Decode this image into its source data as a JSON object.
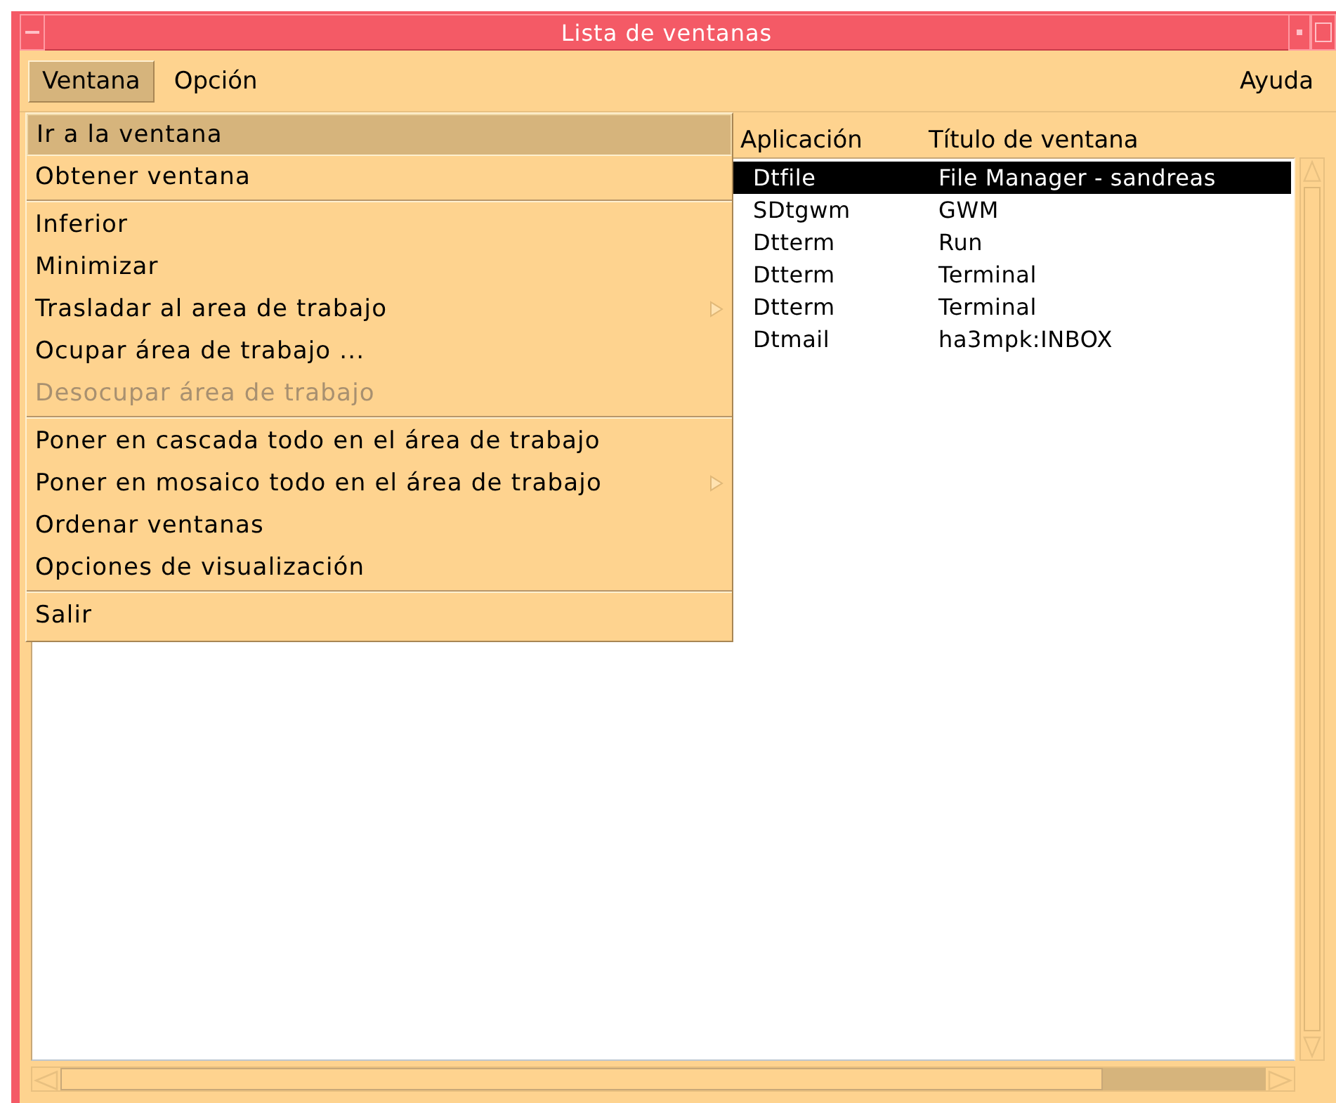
{
  "window": {
    "title": "Lista de ventanas"
  },
  "menubar": {
    "items": [
      {
        "label": "Ventana",
        "selected": true
      },
      {
        "label": "Opción",
        "selected": false
      }
    ],
    "help": {
      "label": "Ayuda"
    }
  },
  "menu": {
    "groups": [
      [
        {
          "label": "Ir a la ventana",
          "selected": true,
          "disabled": false,
          "submenu": false
        },
        {
          "label": "Obtener ventana",
          "selected": false,
          "disabled": false,
          "submenu": false
        }
      ],
      [
        {
          "label": "Inferior",
          "selected": false,
          "disabled": false,
          "submenu": false
        },
        {
          "label": "Minimizar",
          "selected": false,
          "disabled": false,
          "submenu": false
        },
        {
          "label": "Trasladar al area de trabajo",
          "selected": false,
          "disabled": false,
          "submenu": true
        },
        {
          "label": "Ocupar área de trabajo ...",
          "selected": false,
          "disabled": false,
          "submenu": false
        },
        {
          "label": "Desocupar área de trabajo",
          "selected": false,
          "disabled": true,
          "submenu": false
        }
      ],
      [
        {
          "label": "Poner en cascada todo en el área de trabajo",
          "selected": false,
          "disabled": false,
          "submenu": false
        },
        {
          "label": "Poner en mosaico todo en el área de trabajo",
          "selected": false,
          "disabled": false,
          "submenu": true
        },
        {
          "label": "Ordenar ventanas",
          "selected": false,
          "disabled": false,
          "submenu": false
        },
        {
          "label": "Opciones de visualización",
          "selected": false,
          "disabled": false,
          "submenu": false
        }
      ],
      [
        {
          "label": "Salir",
          "selected": false,
          "disabled": false,
          "submenu": false
        }
      ]
    ]
  },
  "table": {
    "columns": [
      "Aplicación",
      "Título de ventana"
    ],
    "rows": [
      {
        "cells": [
          "Dtfile",
          "File Manager - sandreas"
        ],
        "selected": true
      },
      {
        "cells": [
          "SDtgwm",
          "GWM"
        ],
        "selected": false
      },
      {
        "cells": [
          "Dtterm",
          "Run"
        ],
        "selected": false
      },
      {
        "cells": [
          "Dtterm",
          "Terminal"
        ],
        "selected": false
      },
      {
        "cells": [
          "Dtterm",
          "Terminal"
        ],
        "selected": false
      },
      {
        "cells": [
          "Dtmail",
          "ha3mpk:INBOX"
        ],
        "selected": false
      }
    ]
  }
}
